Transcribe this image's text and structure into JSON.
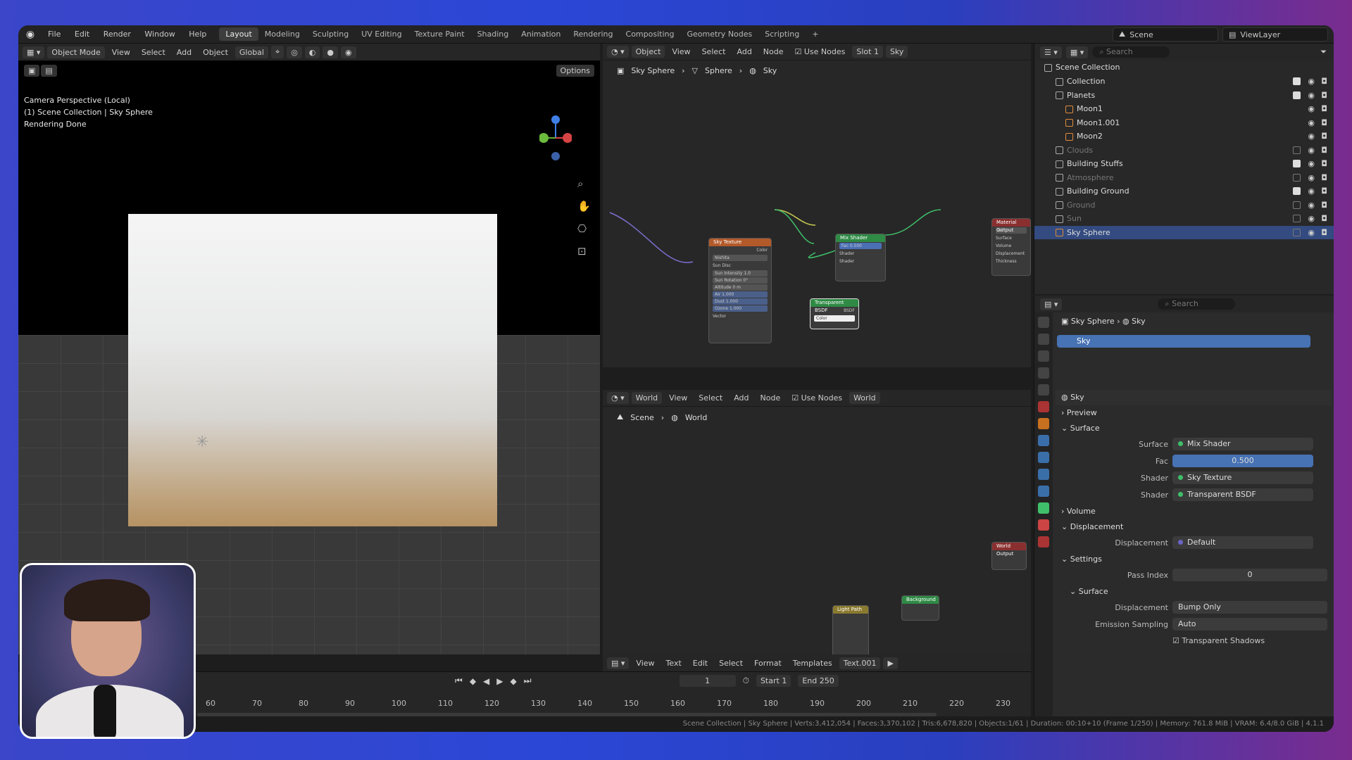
{
  "topbar": {
    "menus": [
      "File",
      "Edit",
      "Render",
      "Window",
      "Help"
    ],
    "workspaces": [
      "Layout",
      "Modeling",
      "Sculpting",
      "UV Editing",
      "Texture Paint",
      "Shading",
      "Animation",
      "Rendering",
      "Compositing",
      "Geometry Nodes",
      "Scripting"
    ],
    "active_workspace": "Layout",
    "add": "+",
    "scene": "Scene",
    "viewlayer": "ViewLayer"
  },
  "viewport": {
    "mode": "Object Mode",
    "menus": [
      "View",
      "Select",
      "Add",
      "Object"
    ],
    "orientation": "Global",
    "options": "Options",
    "info": [
      "Camera Perspective (Local)",
      "(1) Scene Collection | Sky Sphere",
      "Rendering Done"
    ]
  },
  "node_editor": {
    "type": "Object",
    "menus": [
      "View",
      "Select",
      "Add",
      "Node"
    ],
    "use_nodes": "Use Nodes",
    "slot": "Slot 1",
    "material": "Sky",
    "breadcrumb": [
      "Sky Sphere",
      "Sphere",
      "Sky"
    ],
    "nodes": {
      "sky_texture": {
        "title": "Sky Texture",
        "type": "Nishita",
        "sun_disc": "Sun Disc",
        "sun_intensity": "Sun Intensity",
        "sun_intensity_val": "1.0",
        "sun_rotation": "Sun Rotation",
        "sun_rotation_val": "0°",
        "altitude": "Altitude",
        "altitude_val": "0 m",
        "air": "Air",
        "air_val": "1.000",
        "dust": "Dust",
        "dust_val": "1.000",
        "ozone": "Ozone",
        "ozone_val": "1.000",
        "color": "Color",
        "vector": "Vector"
      },
      "mix_shader": {
        "title": "Mix Shader",
        "fac": "Fac",
        "fac_val": "0.500",
        "shader": "Shader"
      },
      "transparent": {
        "title": "Transparent BSDF",
        "color": "Color",
        "bsdf": "BSDF"
      },
      "material_output": {
        "title": "Material Output",
        "target": "All",
        "surface": "Surface",
        "volume": "Volume",
        "displacement": "Displacement",
        "thickness": "Thickness"
      }
    }
  },
  "world_editor": {
    "type": "World",
    "menus": [
      "View",
      "Select",
      "Add",
      "Node"
    ],
    "use_nodes": "Use Nodes",
    "world": "World",
    "breadcrumb": [
      "Scene",
      "World"
    ],
    "nodes": {
      "lightpath": "Light Path",
      "background": "Background",
      "output": "World Output"
    }
  },
  "text_editor": {
    "menus": [
      "View",
      "Text",
      "Edit",
      "Select",
      "Format",
      "Templates"
    ],
    "file": "Text.001"
  },
  "timeline": {
    "frame": "1",
    "start_label": "Start",
    "start": "1",
    "end_label": "End",
    "end": "250",
    "ticks": [
      "60",
      "70",
      "80",
      "90",
      "100",
      "110",
      "120",
      "130",
      "140",
      "150",
      "160",
      "170",
      "180",
      "190",
      "200",
      "210",
      "220",
      "230"
    ]
  },
  "status": "Scene Collection | Sky Sphere | Verts:3,412,054 | Faces:3,370,102 | Tris:6,678,820 | Objects:1/61 | Duration: 00:10+10 (Frame 1/250) | Memory: 761.8 MiB | VRAM: 6.4/8.0 GiB | 4.1.1",
  "outliner": {
    "search": "Search",
    "root": "Scene Collection",
    "rows": [
      {
        "name": "Collection",
        "level": 1,
        "state": "on"
      },
      {
        "name": "Planets",
        "level": 1,
        "state": "on",
        "open": true
      },
      {
        "name": "Moon1",
        "level": 2,
        "state": "plain",
        "obj": true
      },
      {
        "name": "Moon1.001",
        "level": 2,
        "state": "plain",
        "obj": true
      },
      {
        "name": "Moon2",
        "level": 2,
        "state": "plain",
        "obj": true
      },
      {
        "name": "Clouds",
        "level": 1,
        "state": "dim"
      },
      {
        "name": "Building Stuffs",
        "level": 1,
        "state": "on"
      },
      {
        "name": "Atmosphere",
        "level": 1,
        "state": "dim"
      },
      {
        "name": "Building Ground",
        "level": 1,
        "state": "on"
      },
      {
        "name": "Ground",
        "level": 1,
        "state": "dim"
      },
      {
        "name": "Sun",
        "level": 1,
        "state": "dim"
      },
      {
        "name": "Sky Sphere",
        "level": 1,
        "state": "sel",
        "obj": true
      }
    ]
  },
  "properties": {
    "search": "Search",
    "breadcrumb": [
      "Sky Sphere",
      "Sky"
    ],
    "slot": "Sky",
    "material_name": "Sky",
    "sections": {
      "preview": "Preview",
      "surface": "Surface",
      "volume": "Volume",
      "displacement": "Displacement",
      "settings": "Settings",
      "surface2": "Surface"
    },
    "surface_label": "Surface",
    "surface_value": "Mix Shader",
    "fac_label": "Fac",
    "fac_value": "0.500",
    "shader_label": "Shader",
    "shader1": "Sky Texture",
    "shader2": "Transparent BSDF",
    "disp_label": "Displacement",
    "disp_value": "Default",
    "pass_label": "Pass Index",
    "pass_value": "0",
    "disp2_label": "Displacement",
    "disp2_value": "Bump Only",
    "emission_label": "Emission Sampling",
    "emission_value": "Auto",
    "transparent_shadows": "Transparent Shadows",
    "transparent_shadows_checked": true
  }
}
